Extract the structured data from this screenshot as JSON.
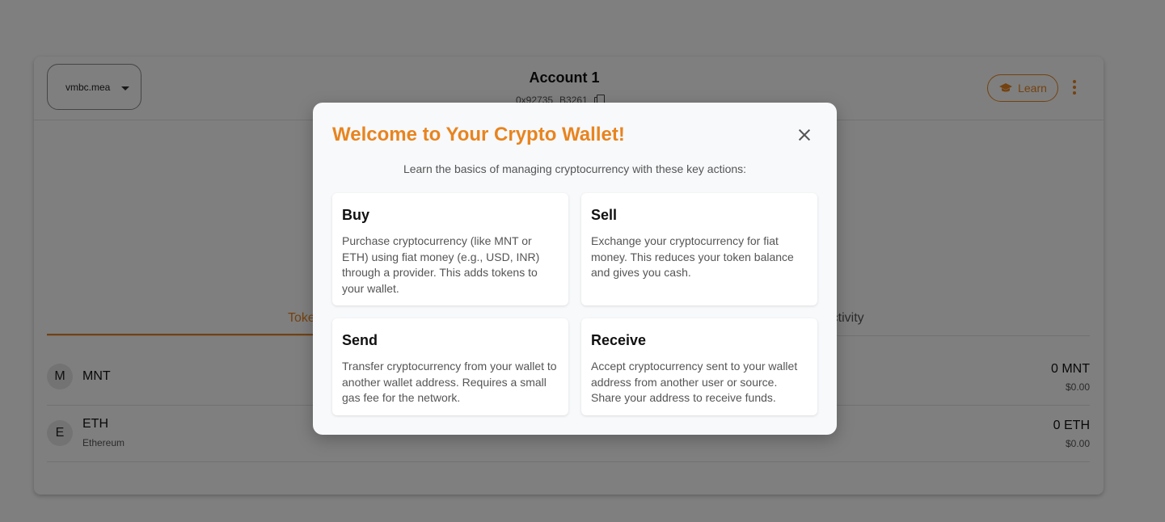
{
  "header": {
    "network_label": "vmbc.mea",
    "account_name": "Account 1",
    "address_start": "0x92735",
    "address_end": "B3261",
    "learn_label": "Learn"
  },
  "tabs": [
    {
      "label": "Tokens"
    },
    {
      "label": "Activity"
    }
  ],
  "tokens": [
    {
      "avatar": "M",
      "symbol": "MNT",
      "name": "",
      "balance": "0 MNT",
      "value": "$0.00"
    },
    {
      "avatar": "E",
      "symbol": "ETH",
      "name": "Ethereum",
      "balance": "0 ETH",
      "value": "$0.00"
    }
  ],
  "modal": {
    "title": "Welcome to Your Crypto Wallet!",
    "subtitle": "Learn the basics of managing cryptocurrency with these key actions:",
    "actions": [
      {
        "title": "Buy",
        "description": "Purchase cryptocurrency (like MNT or ETH) using fiat money (e.g., USD, INR) through a provider. This adds tokens to your wallet."
      },
      {
        "title": "Sell",
        "description": "Exchange your cryptocurrency for fiat money. This reduces your token balance and gives you cash."
      },
      {
        "title": "Send",
        "description": "Transfer cryptocurrency from your wallet to another wallet address. Requires a small gas fee for the network."
      },
      {
        "title": "Receive",
        "description": "Accept cryptocurrency sent to your wallet address from another user or source. Share your address to receive funds."
      }
    ]
  },
  "colors": {
    "accent": "#e8841f",
    "overlay": "rgba(0,0,0,0.5)",
    "modal_bg": "#f8f9fb"
  },
  "icons": {
    "learn": "graduation-cap-icon",
    "menu": "more-vertical-icon",
    "copy": "copy-icon",
    "close": "close-icon",
    "network_caret": "caret-down-icon"
  }
}
